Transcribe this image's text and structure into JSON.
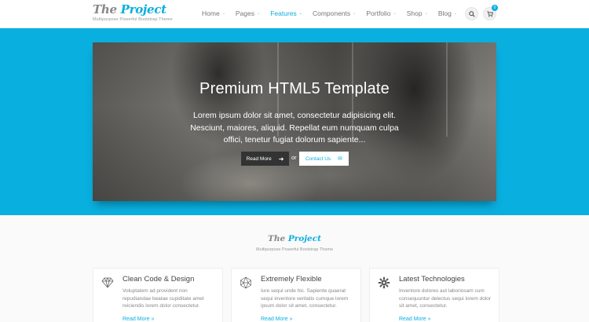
{
  "brand": {
    "logo_part1": "The ",
    "logo_part2": "Project",
    "tagline": "Multipurpose Powerful Bootstrap Theme"
  },
  "nav": {
    "items": [
      {
        "label": "Home",
        "active": false
      },
      {
        "label": "Pages",
        "active": false
      },
      {
        "label": "Features",
        "active": true
      },
      {
        "label": "Components",
        "active": false
      },
      {
        "label": "Portfolio",
        "active": false
      },
      {
        "label": "Shop",
        "active": false
      },
      {
        "label": "Blog",
        "active": false
      }
    ],
    "search_icon": "search-icon",
    "cart_icon": "cart-icon",
    "cart_count": "0"
  },
  "hero": {
    "title": "Premium HTML5 Template",
    "text": "Lorem ipsum dolor sit amet, consectetur adipisicing elit. Nesciunt, maiores, aliquid. Repellat eum numquam culpa offici, tenetur fugiat dolorum sapiente...",
    "read_more": "Read More",
    "or": "or",
    "contact": "Contact Us"
  },
  "section": {
    "logo_part1": "The ",
    "logo_part2": "Project",
    "subtitle": "Multipurpose Powerful Bootstrap Theme"
  },
  "features": [
    {
      "icon": "diamond-icon",
      "title": "Clean Code & Design",
      "text": "Voluptatem ad provident non repudiandae beatae cupiditate amet reiciendis lorem dolor consectetur.",
      "link": "Read More"
    },
    {
      "icon": "polyhedron-icon",
      "title": "Extremely Flexible",
      "text": "Iure sequi unde hic. Sapiente quaerat sequi inventore veritatis cumque lorem ipsum dolor sit amet, consectetur.",
      "link": "Read More"
    },
    {
      "icon": "cog-icon",
      "title": "Latest Technologies",
      "text": "Inventore dolores aut laboriosam cum consequuntur delectus sequi lorem dolor sit amet, consectetur.",
      "link": "Read More"
    }
  ],
  "colors": {
    "accent": "#09afdf",
    "dark_button": "#333333"
  }
}
